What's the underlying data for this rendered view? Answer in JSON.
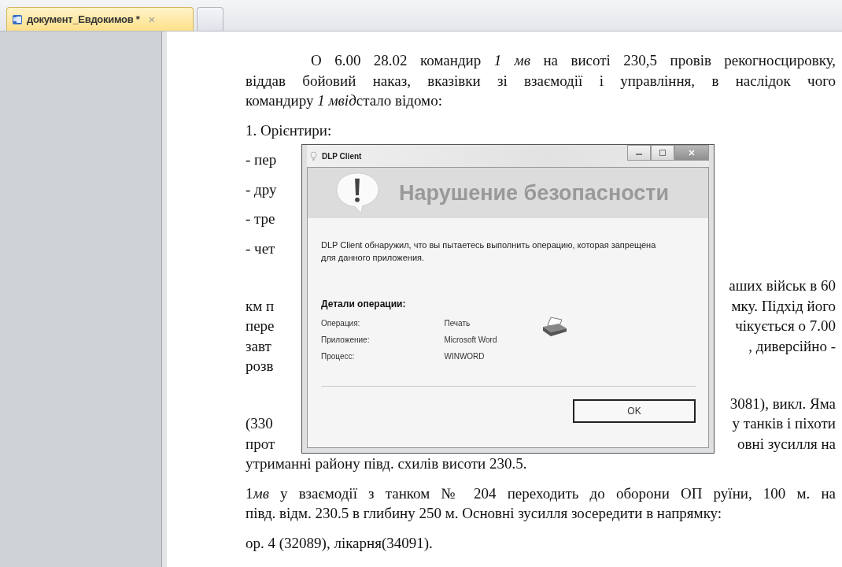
{
  "tabs": [
    {
      "label": "документ_Евдокимов *",
      "close": "×",
      "selected": true
    },
    {
      "selected": false
    }
  ],
  "document": {
    "paragraphs": [
      {
        "kind": "indented",
        "lines": [
          {
            "text": "О 6.00 28.02 командир *1 мв* на висоті 230,5 провів рекогносцировку,"
          },
          {
            "text": "віддав бойовий наказ, вказівки зі взаємодії і управління, в наслідок чого"
          },
          {
            "segments": [
              {
                "text": "командиру "
              },
              {
                "text": "1 мвід",
                "italic": true
              },
              {
                "text": "стало відомо:"
              }
            ]
          }
        ]
      },
      {
        "kind": "plain",
        "lines": [
          {
            "text": "1. Орієнтири:"
          }
        ]
      },
      {
        "kind": "plain",
        "lines": [
          {
            "left": "- пер"
          }
        ]
      },
      {
        "kind": "plain",
        "lines": [
          {
            "left": "- дру"
          }
        ]
      },
      {
        "kind": "plain",
        "lines": [
          {
            "left": "- тре"
          }
        ]
      },
      {
        "kind": "plain",
        "lines": [
          {
            "left": "- чет"
          }
        ]
      },
      {
        "kind": "spaced",
        "lines": [
          {
            "right": "аших військ в 60"
          },
          {
            "left": "км п",
            "right": "мку. Підхід його"
          },
          {
            "left": "пере",
            "right": "чікується о 7.00"
          },
          {
            "left": "завт",
            "right": ", диверсійно -"
          },
          {
            "left": "розв"
          }
        ]
      },
      {
        "kind": "spaced",
        "lines": [
          {
            "right": "3081), викл. Яма"
          },
          {
            "left": "(330",
            "right": "у танків і піхоти"
          },
          {
            "left": "прот",
            "right": "овні зусилля на"
          },
          {
            "text": "утриманні району півд. схилів висоти 230.5."
          }
        ]
      },
      {
        "kind": "plain",
        "lines": [
          {
            "segments": [
              {
                "text": "1"
              },
              {
                "text": "мв",
                "italic": true
              },
              {
                "text": " у взаємодії з танком № 204 переходить до оборони ОП руїни, 100 м. на"
              }
            ]
          },
          {
            "text": "півд. відм. 230.5 в глибину 250 м. Основні зусилля зосередити в напрямку:"
          }
        ]
      },
      {
        "kind": "plain",
        "lines": [
          {
            "text": "ор. 4 (32089), лікарня(34091)."
          }
        ]
      }
    ]
  },
  "dialog": {
    "title": "DLP Client",
    "heading": "Нарушение безопасности",
    "message": "DLP Client обнаружил, что вы пытаетесь выполнить операцию, которая запрещена для данного приложения.",
    "details_title": "Детали операции:",
    "details": [
      {
        "label": "Операция:",
        "value": "Печать"
      },
      {
        "label": "Приложение:",
        "value": "Microsoft Word"
      },
      {
        "label": "Процесс:",
        "value": "WINWORD"
      }
    ],
    "button": "OK"
  }
}
